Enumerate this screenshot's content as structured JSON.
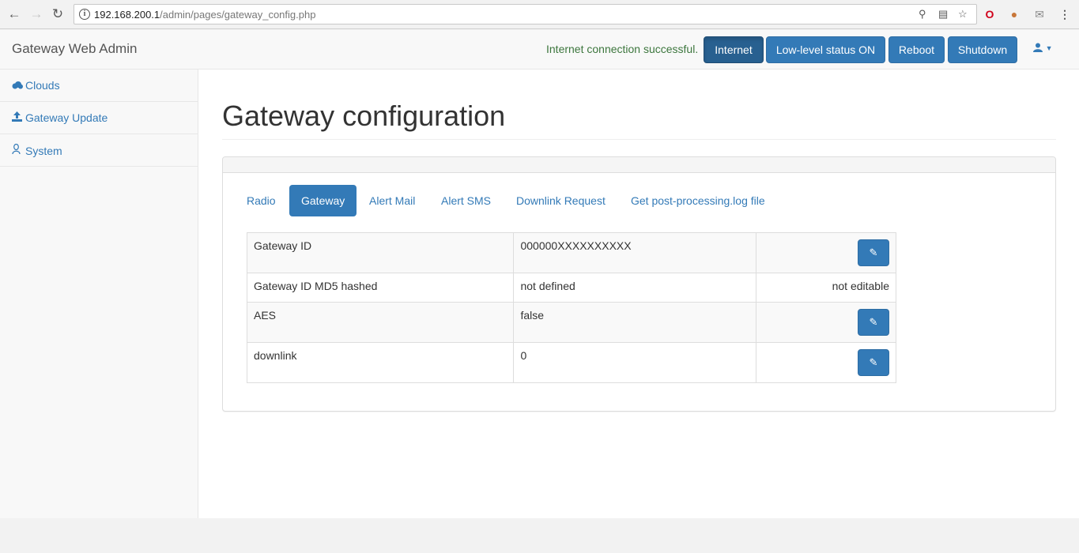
{
  "browser": {
    "url_host": "192.168.200.1",
    "url_path": "/admin/pages/gateway_config.php"
  },
  "navbar": {
    "brand": "Gateway Web Admin",
    "connection_status": "Internet connection successful.",
    "buttons": [
      {
        "label": "Internet",
        "active": true
      },
      {
        "label": "Low-level status ON"
      },
      {
        "label": "Reboot"
      },
      {
        "label": "Shutdown"
      }
    ]
  },
  "sidebar": {
    "items": [
      {
        "label": "Clouds",
        "icon": "cloud-icon"
      },
      {
        "label": "Gateway Update",
        "icon": "upload-icon"
      },
      {
        "label": "System",
        "icon": "linux-icon"
      }
    ]
  },
  "main": {
    "title": "Gateway configuration",
    "tabs": [
      "Radio",
      "Gateway",
      "Alert Mail",
      "Alert SMS",
      "Downlink Request",
      "Get post-processing.log file"
    ],
    "active_tab": "Gateway",
    "rows": [
      {
        "name": "Gateway ID",
        "value": "000000XXXXXXXXXX",
        "action": "edit"
      },
      {
        "name": "Gateway ID MD5 hashed",
        "value": "not defined",
        "action": "not editable"
      },
      {
        "name": "AES",
        "value": "false",
        "action": "edit"
      },
      {
        "name": "downlink",
        "value": "0",
        "action": "edit"
      }
    ]
  },
  "colors": {
    "primary": "#337ab7",
    "success_text": "#3c763d"
  }
}
